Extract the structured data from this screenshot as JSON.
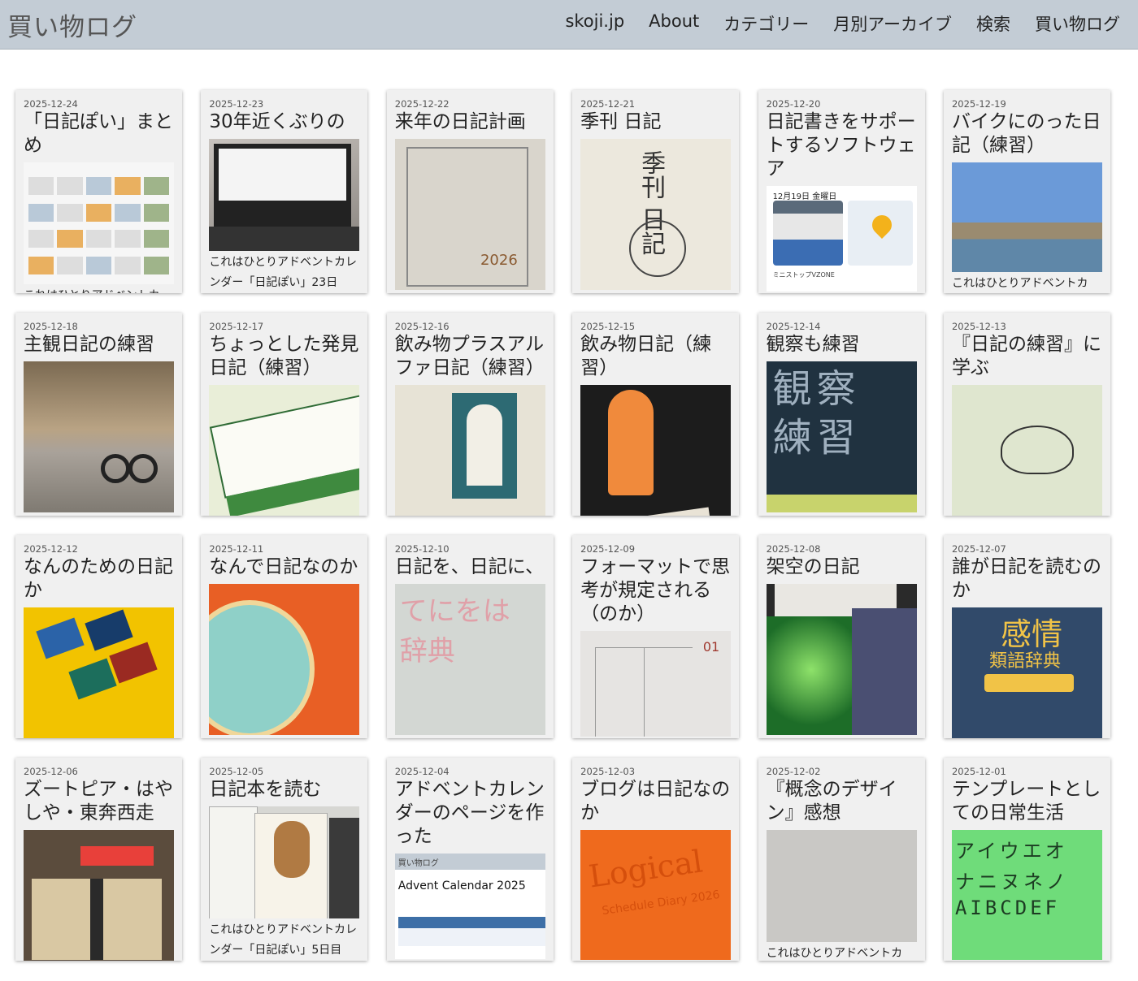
{
  "site": {
    "title": "買い物ログ"
  },
  "nav": [
    "skoji.jp",
    "About",
    "カテゴリー",
    "月別アーカイブ",
    "検索",
    "買い物ログ"
  ],
  "posts": [
    {
      "date": "2025-12-24",
      "title": "「日記ぽい」まとめ",
      "caption": "これはひとりアドベントカ"
    },
    {
      "date": "2025-12-23",
      "title": "30年近くぶりの",
      "caption": "これはひとりアドベントカレンダー「日記ぽい」23日"
    },
    {
      "date": "2025-12-22",
      "title": "来年の日記計画",
      "caption": ""
    },
    {
      "date": "2025-12-21",
      "title": "季刊 日記",
      "caption": ""
    },
    {
      "date": "2025-12-20",
      "title": "日記書きをサポートするソフトウェア",
      "caption": ""
    },
    {
      "date": "2025-12-19",
      "title": "バイクにのった日記（練習）",
      "caption": "これはひとりアドベントカ"
    },
    {
      "date": "2025-12-18",
      "title": "主観日記の練習",
      "caption": ""
    },
    {
      "date": "2025-12-17",
      "title": "ちょっとした発見日記（練習）",
      "caption": ""
    },
    {
      "date": "2025-12-16",
      "title": "飲み物プラスアルファ日記（練習）",
      "caption": ""
    },
    {
      "date": "2025-12-15",
      "title": "飲み物日記（練習）",
      "caption": ""
    },
    {
      "date": "2025-12-14",
      "title": "観察も練習",
      "caption": ""
    },
    {
      "date": "2025-12-13",
      "title": "『日記の練習』に学ぶ",
      "caption": ""
    },
    {
      "date": "2025-12-12",
      "title": "なんのための日記か",
      "caption": ""
    },
    {
      "date": "2025-12-11",
      "title": "なんで日記なのか",
      "caption": ""
    },
    {
      "date": "2025-12-10",
      "title": "日記を、日記に、",
      "caption": ""
    },
    {
      "date": "2025-12-09",
      "title": "フォーマットで思考が規定される（のか）",
      "caption": ""
    },
    {
      "date": "2025-12-08",
      "title": "架空の日記",
      "caption": ""
    },
    {
      "date": "2025-12-07",
      "title": "誰が日記を読むのか",
      "caption": ""
    },
    {
      "date": "2025-12-06",
      "title": "ズートピア・はやしや・東奔西走",
      "caption": ""
    },
    {
      "date": "2025-12-05",
      "title": "日記本を読む",
      "caption": "これはひとりアドベントカレンダー「日記ぽい」5日目"
    },
    {
      "date": "2025-12-04",
      "title": "アドベントカレンダーのページを作った",
      "caption": ""
    },
    {
      "date": "2025-12-03",
      "title": "ブログは日記なのか",
      "caption": ""
    },
    {
      "date": "2025-12-02",
      "title": "『概念のデザイン』感想",
      "caption": "これはひとりアドベントカ"
    },
    {
      "date": "2025-12-01",
      "title": "テンプレートとしての日常生活",
      "caption": ""
    }
  ],
  "thumb_text": {
    "kikan": "季刊 日記",
    "year2026": "2026",
    "app_date": "12月19日 金曜日",
    "app_place": "ミニストップVZONE",
    "kansatsu": "観察 練習",
    "dict": "てにをは 辞典",
    "jan": "01",
    "emotion1": "感情",
    "emotion2": "類語辞典",
    "advent_head": "買い物ログ",
    "advent_title": "Advent Calendar 2025",
    "logical": "Logical",
    "logical_sub": "Schedule Diary 2026",
    "stencil1": "アイウエオ",
    "stencil2": "ナニヌネノ",
    "stencil3": "AIBCDEF"
  },
  "colors": {
    "header_bg": "#c3ccd5",
    "card_bg": "#f0f0f0"
  }
}
